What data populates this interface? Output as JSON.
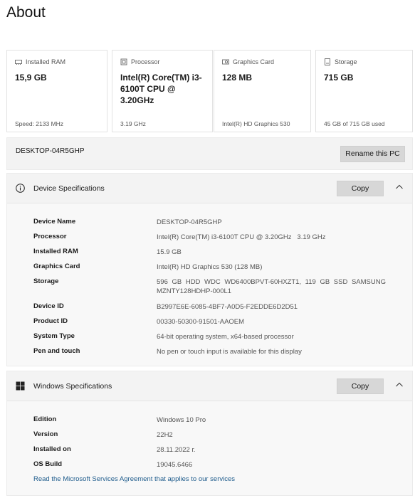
{
  "page": {
    "title": "About"
  },
  "cards": [
    {
      "id": "ram",
      "label": "Installed RAM",
      "icon": "ram-icon",
      "value": "15,9 GB",
      "sub": "Speed: 2133 MHz"
    },
    {
      "id": "cpu",
      "label": "Processor",
      "icon": "processor-icon",
      "value": "Intel(R) Core(TM) i3-6100T CPU @ 3.20GHz",
      "sub": "3.19 GHz"
    },
    {
      "id": "gpu",
      "label": "Graphics Card",
      "icon": "graphics-card-icon",
      "value": "128 MB",
      "sub": "Intel(R) HD Graphics 530"
    },
    {
      "id": "storage",
      "label": "Storage",
      "icon": "storage-icon",
      "value": "715 GB",
      "sub": "45 GB of 715 GB used"
    }
  ],
  "pc": {
    "name": "DESKTOP-04R5GHP",
    "rename_label": "Rename this PC"
  },
  "device_specs": {
    "title": "Device Specifications",
    "copy_label": "Copy",
    "rows": [
      {
        "label": "Device Name",
        "value": "DESKTOP-04R5GHP"
      },
      {
        "label": "Processor",
        "value": "Intel(R) Core(TM) i3-6100T CPU @ 3.20GHz   3.19 GHz"
      },
      {
        "label": "Installed RAM",
        "value": "15.9 GB"
      },
      {
        "label": "Graphics Card",
        "value": "Intel(R) HD Graphics 530 (128 MB)"
      },
      {
        "label": "Storage",
        "value": "596 GB HDD WDC WD6400BPVT-60HXZT1, 119 GB SSD SAMSUNG MZNTY128HDHP-000L1"
      },
      {
        "label": "Device ID",
        "value": "B2997E6E-6085-4BF7-A0D5-F2EDDE6D2D51"
      },
      {
        "label": "Product ID",
        "value": "00330-50300-91501-AAOEM"
      },
      {
        "label": "System Type",
        "value": "64-bit operating system, x64-based processor"
      },
      {
        "label": "Pen and touch",
        "value": "No pen or touch input is available for this display"
      }
    ]
  },
  "windows_specs": {
    "title": "Windows Specifications",
    "copy_label": "Copy",
    "rows": [
      {
        "label": "Edition",
        "value": "Windows 10 Pro"
      },
      {
        "label": "Version",
        "value": "22H2"
      },
      {
        "label": "Installed on",
        "value": "28.11.2022 г."
      },
      {
        "label": "OS Build",
        "value": "19045.6466"
      }
    ],
    "link": "Read the Microsoft Services Agreement that applies to our services"
  },
  "colors": {
    "accent_link": "#1f5c8c",
    "button_bg": "#d7d7d7",
    "panel_bg": "#f3f3f3"
  }
}
